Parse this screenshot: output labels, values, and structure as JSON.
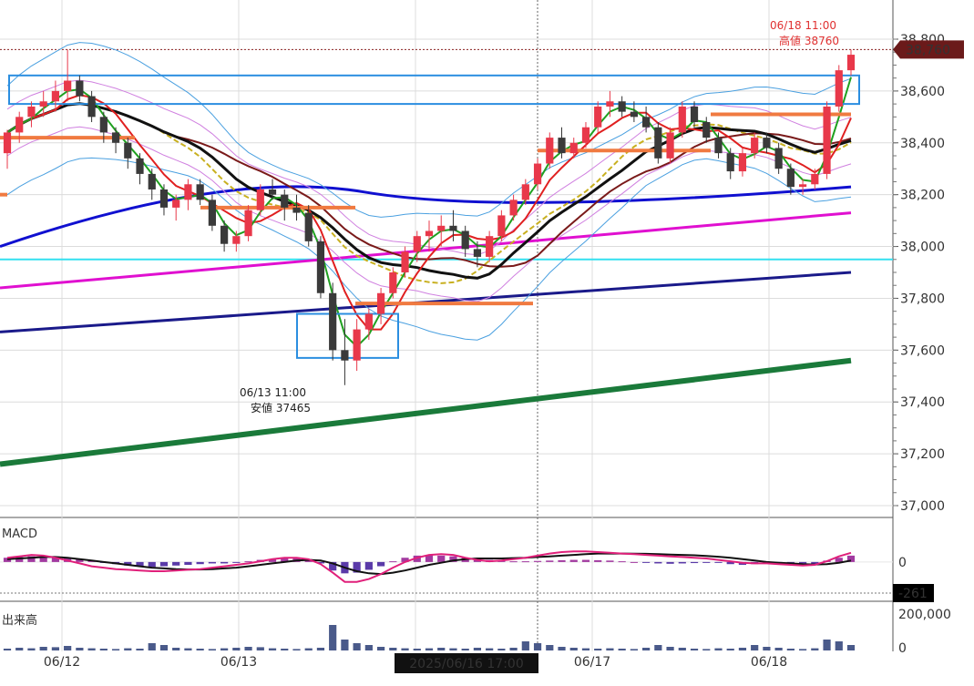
{
  "chart_data": {
    "type": "candlestick",
    "price_axis": {
      "ylim": [
        37000,
        38800
      ],
      "ticks": [
        "37,000",
        "37,200",
        "37,400",
        "37,600",
        "37,800",
        "38,000",
        "38,200",
        "38,400",
        "38,600",
        "38,800"
      ]
    },
    "x_labels": [
      "06/12",
      "06/13",
      "06/17",
      "06/18"
    ],
    "crosshair_label": "2025/06/16 17:00",
    "last_price_label": "38,760",
    "high_annotation": {
      "time": "06/18 11:00",
      "text": "高値 38760",
      "value": 38760
    },
    "low_annotation": {
      "time": "06/13 11:00",
      "text": "安値 37465",
      "value": 37465
    },
    "horizontal_line": 37950,
    "candles": [
      [
        38360,
        38450,
        38300,
        38440
      ],
      [
        38440,
        38520,
        38400,
        38500
      ],
      [
        38500,
        38560,
        38460,
        38540
      ],
      [
        38540,
        38600,
        38500,
        38560
      ],
      [
        38560,
        38640,
        38520,
        38600
      ],
      [
        38600,
        38760,
        38560,
        38640
      ],
      [
        38640,
        38660,
        38560,
        38580
      ],
      [
        38580,
        38600,
        38480,
        38500
      ],
      [
        38500,
        38520,
        38400,
        38440
      ],
      [
        38440,
        38460,
        38360,
        38400
      ],
      [
        38400,
        38420,
        38300,
        38340
      ],
      [
        38340,
        38360,
        38240,
        38280
      ],
      [
        38280,
        38300,
        38180,
        38220
      ],
      [
        38220,
        38240,
        38120,
        38150
      ],
      [
        38150,
        38200,
        38100,
        38180
      ],
      [
        38180,
        38260,
        38140,
        38240
      ],
      [
        38240,
        38260,
        38160,
        38180
      ],
      [
        38180,
        38200,
        38060,
        38080
      ],
      [
        38080,
        38100,
        37980,
        38010
      ],
      [
        38010,
        38060,
        37980,
        38040
      ],
      [
        38040,
        38160,
        38020,
        38140
      ],
      [
        38140,
        38240,
        38120,
        38220
      ],
      [
        38220,
        38260,
        38180,
        38200
      ],
      [
        38200,
        38220,
        38100,
        38150
      ],
      [
        38150,
        38200,
        38100,
        38130
      ],
      [
        38130,
        38160,
        38000,
        38020
      ],
      [
        38020,
        38040,
        37800,
        37820
      ],
      [
        37820,
        37860,
        37560,
        37600
      ],
      [
        37600,
        37720,
        37465,
        37560
      ],
      [
        37560,
        37720,
        37520,
        37680
      ],
      [
        37680,
        37760,
        37640,
        37740
      ],
      [
        37740,
        37840,
        37700,
        37820
      ],
      [
        37820,
        37920,
        37800,
        37900
      ],
      [
        37900,
        38000,
        37880,
        37980
      ],
      [
        37980,
        38060,
        37940,
        38040
      ],
      [
        38040,
        38100,
        37980,
        38060
      ],
      [
        38060,
        38120,
        38000,
        38080
      ],
      [
        38080,
        38140,
        38020,
        38060
      ],
      [
        38060,
        38080,
        37960,
        37990
      ],
      [
        37990,
        38020,
        37920,
        37960
      ],
      [
        37960,
        38060,
        37940,
        38040
      ],
      [
        38040,
        38140,
        38020,
        38120
      ],
      [
        38120,
        38200,
        38100,
        38180
      ],
      [
        38180,
        38260,
        38160,
        38240
      ],
      [
        38240,
        38340,
        38220,
        38320
      ],
      [
        38320,
        38440,
        38300,
        38420
      ],
      [
        38420,
        38460,
        38340,
        38360
      ],
      [
        38360,
        38420,
        38340,
        38400
      ],
      [
        38400,
        38480,
        38380,
        38460
      ],
      [
        38460,
        38560,
        38440,
        38540
      ],
      [
        38540,
        38600,
        38500,
        38560
      ],
      [
        38560,
        38580,
        38500,
        38520
      ],
      [
        38520,
        38560,
        38480,
        38500
      ],
      [
        38500,
        38540,
        38440,
        38460
      ],
      [
        38460,
        38480,
        38320,
        38340
      ],
      [
        38340,
        38460,
        38320,
        38440
      ],
      [
        38440,
        38560,
        38420,
        38540
      ],
      [
        38540,
        38560,
        38460,
        38480
      ],
      [
        38480,
        38500,
        38400,
        38420
      ],
      [
        38420,
        38440,
        38340,
        38360
      ],
      [
        38360,
        38380,
        38260,
        38290
      ],
      [
        38290,
        38380,
        38270,
        38360
      ],
      [
        38360,
        38440,
        38340,
        38420
      ],
      [
        38420,
        38440,
        38360,
        38380
      ],
      [
        38380,
        38400,
        38280,
        38300
      ],
      [
        38300,
        38320,
        38200,
        38230
      ],
      [
        38230,
        38260,
        38200,
        38240
      ],
      [
        38240,
        38300,
        38220,
        38280
      ],
      [
        38280,
        38560,
        38260,
        38540
      ],
      [
        38540,
        38700,
        38520,
        38680
      ],
      [
        38680,
        38760,
        38660,
        38740
      ]
    ],
    "macd": {
      "label": "MACD",
      "ylim": [
        -400,
        500
      ],
      "tick_labels": [
        "0"
      ],
      "zero_label": "0",
      "current_label": "-261",
      "histogram": [
        60,
        70,
        80,
        75,
        70,
        60,
        40,
        20,
        -10,
        -30,
        -50,
        -60,
        -70,
        -60,
        -50,
        -40,
        -30,
        -20,
        -20,
        -10,
        10,
        30,
        40,
        50,
        50,
        40,
        -20,
        -120,
        -160,
        -150,
        -110,
        -60,
        10,
        60,
        90,
        100,
        90,
        80,
        60,
        40,
        30,
        20,
        10,
        10,
        15,
        20,
        25,
        30,
        30,
        25,
        20,
        10,
        0,
        -10,
        -20,
        -25,
        -20,
        -15,
        -10,
        -10,
        -30,
        -40,
        -30,
        -20,
        -10,
        -10,
        -20,
        -30,
        20,
        60,
        90
      ],
      "macd_line": [
        60,
        80,
        100,
        90,
        60,
        20,
        -20,
        -60,
        -80,
        -100,
        -110,
        -120,
        -130,
        -130,
        -120,
        -110,
        -100,
        -80,
        -60,
        -40,
        -20,
        10,
        40,
        60,
        60,
        40,
        -30,
        -150,
        -280,
        -280,
        -240,
        -170,
        -80,
        0,
        60,
        100,
        110,
        100,
        60,
        30,
        10,
        20,
        40,
        60,
        90,
        120,
        140,
        150,
        150,
        140,
        130,
        120,
        110,
        100,
        90,
        80,
        70,
        60,
        50,
        30,
        10,
        -10,
        -20,
        -20,
        -30,
        -40,
        -50,
        -40,
        10,
        80,
        130
      ],
      "signal_line": [
        40,
        50,
        60,
        70,
        70,
        60,
        40,
        20,
        0,
        -20,
        -40,
        -60,
        -80,
        -90,
        -100,
        -105,
        -105,
        -100,
        -90,
        -80,
        -60,
        -40,
        -20,
        0,
        20,
        30,
        20,
        -20,
        -80,
        -130,
        -160,
        -170,
        -150,
        -120,
        -80,
        -40,
        -10,
        20,
        40,
        50,
        50,
        50,
        55,
        60,
        70,
        80,
        90,
        100,
        110,
        120,
        120,
        120,
        118,
        115,
        110,
        105,
        100,
        95,
        85,
        75,
        60,
        40,
        20,
        0,
        -10,
        -20,
        -30,
        -35,
        -30,
        -10,
        20
      ]
    },
    "volume": {
      "label": "出来高",
      "ylim": [
        0,
        200000
      ],
      "tick_labels": [
        "0",
        "200,000"
      ],
      "values": [
        10000,
        15000,
        12000,
        20000,
        18000,
        25000,
        15000,
        12000,
        10000,
        8000,
        12000,
        10000,
        40000,
        30000,
        15000,
        12000,
        10000,
        8000,
        12000,
        15000,
        20000,
        18000,
        12000,
        10000,
        8000,
        12000,
        15000,
        140000,
        60000,
        40000,
        30000,
        20000,
        15000,
        12000,
        10000,
        12000,
        15000,
        12000,
        10000,
        15000,
        12000,
        10000,
        15000,
        50000,
        40000,
        30000,
        20000,
        15000,
        12000,
        10000,
        12000,
        10000,
        8000,
        15000,
        30000,
        20000,
        15000,
        10000,
        8000,
        12000,
        10000,
        15000,
        30000,
        20000,
        15000,
        10000,
        8000,
        12000,
        60000,
        50000,
        30000
      ]
    }
  }
}
